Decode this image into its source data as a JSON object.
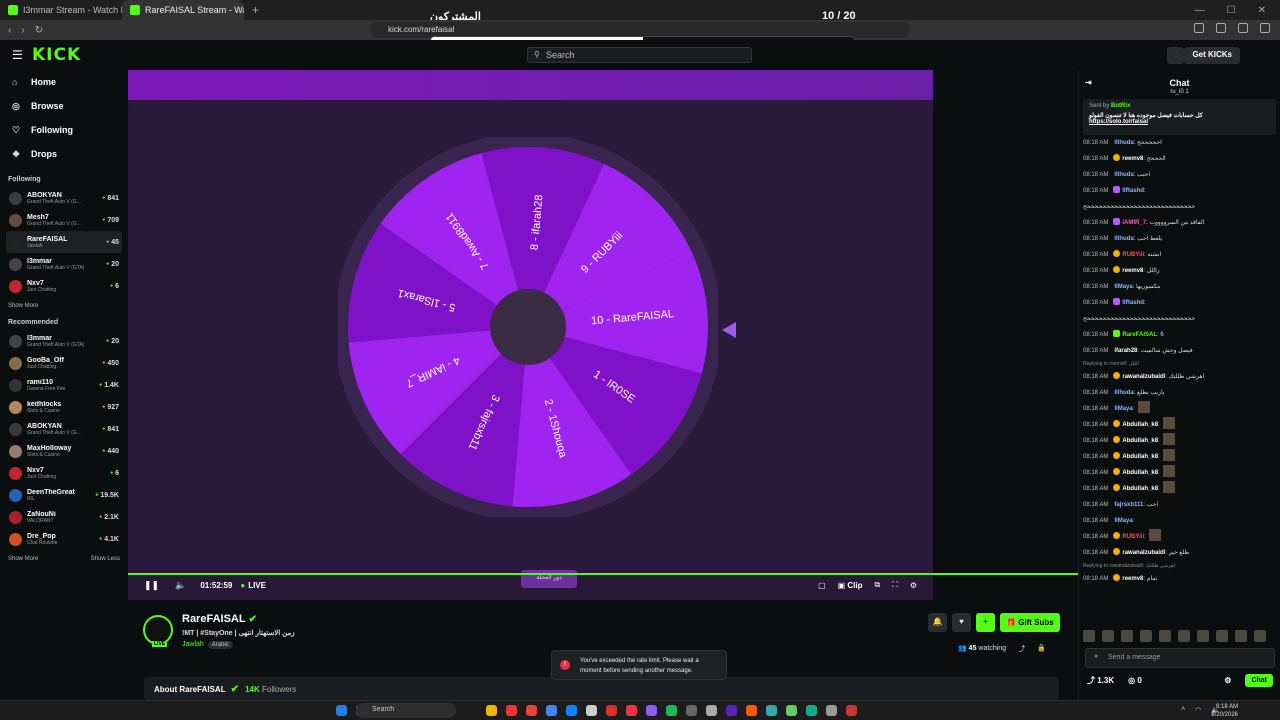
{
  "browser": {
    "tabs": [
      {
        "label": "I3mmar Stream - Watch Live on K",
        "active": false
      },
      {
        "label": "RareFAISAL Stream - Watch Li",
        "active": true
      }
    ],
    "url": "kick.com/rarefaisal",
    "overlay_title": "المشتركون",
    "overlay_count": "10 / 20",
    "overlay_progress": 0.5
  },
  "topbar": {
    "logo": "KICK",
    "search_placeholder": "Search",
    "get_kicks": "Get KICKs"
  },
  "sidebar": {
    "nav": [
      {
        "label": "Home",
        "icon": "home-icon"
      },
      {
        "label": "Browse",
        "icon": "compass-icon"
      },
      {
        "label": "Following",
        "icon": "heart-icon"
      },
      {
        "label": "Drops",
        "icon": "drops-icon"
      }
    ],
    "following_title": "Following",
    "following": [
      {
        "name": "ABOKYAN",
        "cat": "Grand Theft Auto V (G...",
        "viewers": "841",
        "color": "#3b3b3b"
      },
      {
        "name": "Mesh7",
        "cat": "Grand Theft Auto V (G...",
        "viewers": "709",
        "color": "#6a4b3a"
      },
      {
        "name": "RareFAISAL",
        "cat": "Jawlah",
        "viewers": "45",
        "color": "#222",
        "active": true
      },
      {
        "name": "I3mmar",
        "cat": "Grand Theft Auto V (GTA)",
        "viewers": "20",
        "color": "#444"
      },
      {
        "name": "Nxv7",
        "cat": "Just Chatting",
        "viewers": "6",
        "color": "#c0262d"
      }
    ],
    "show_more": "Show More",
    "recommended_title": "Recommended",
    "recommended": [
      {
        "name": "I3mmar",
        "cat": "Grand Theft Auto V (GTA)",
        "viewers": "20",
        "color": "#444"
      },
      {
        "name": "GooBa_Off",
        "cat": "Just Chatting",
        "viewers": "450",
        "color": "#8a6a4a"
      },
      {
        "name": "rami110",
        "cat": "Garena Free Fire",
        "viewers": "1.4K",
        "color": "#333"
      },
      {
        "name": "keithlocks",
        "cat": "Slots & Casino",
        "viewers": "927",
        "color": "#b58a5a"
      },
      {
        "name": "ABOKYAN",
        "cat": "Grand Theft Auto V (G...",
        "viewers": "841",
        "color": "#3b3b3b"
      },
      {
        "name": "MaxHolloway",
        "cat": "Slots & Casino",
        "viewers": "440",
        "color": "#9a7a6a"
      },
      {
        "name": "Nxv7",
        "cat": "Just Chatting",
        "viewers": "6",
        "color": "#c0262d"
      },
      {
        "name": "DeenTheGreat",
        "cat": "IRL",
        "viewers": "19.5K",
        "color": "#2b5fb5"
      },
      {
        "name": "ZaNouNi",
        "cat": "VALORANT",
        "viewers": "2.1K",
        "color": "#a8202a"
      },
      {
        "name": "Dre_Pop",
        "cat": "Chat Roulette",
        "viewers": "4.1K",
        "color": "#d0502a"
      }
    ],
    "show_more_2": "Show More",
    "show_less": "Show Less"
  },
  "wheel": {
    "segments": [
      {
        "label": "10 - RareFAISAL"
      },
      {
        "label": "1 - IR0SE"
      },
      {
        "label": "2 - 1Shouqa"
      },
      {
        "label": "3 - fajrsxb11"
      },
      {
        "label": "4 - iAMIR_7"
      },
      {
        "label": "5 - 1lSarax1"
      },
      {
        "label": "7 - Awad8911"
      },
      {
        "label": "8 - ifarah28"
      },
      {
        "label": "9 - RUBYiii"
      }
    ],
    "spin_label": "دور العجلة"
  },
  "player": {
    "time": "01:52:59",
    "live": "LIVE",
    "clip": "Clip"
  },
  "stream": {
    "name": "RareFAISAL",
    "title": "!MT | #StayOne | زمن الاستهتار انتهى",
    "category": "Jawlah",
    "language": "Arabic",
    "watching_count": "45",
    "watching_label": "watching",
    "gift_subs": "Gift Subs",
    "about_prefix": "About",
    "followers": "14K",
    "followers_label": "Followers"
  },
  "toast": {
    "message": "You've exceeded the rate limit. Please wait a moment before sending another message."
  },
  "chat": {
    "title": "Chat",
    "top_user": "ru_i0 1",
    "pinned_by": "Sent by",
    "pinned_user": "BotRix",
    "pinned_msg": "كل حسابات فيصل موجوده هنا لا تنسون الفولو",
    "pinned_url": "https://solo.to/rfaisal",
    "messages": [
      {
        "t": "08:18 AM",
        "u": "lllhuda",
        "c": "#8fb5ff",
        "msg": "احححححح",
        "b": ""
      },
      {
        "t": "08:18 AM",
        "u": "reemv8",
        "c": "#fff",
        "msg": "الحححح",
        "b": "y"
      },
      {
        "t": "08:18 AM",
        "u": "lllhuda",
        "c": "#8fb5ff",
        "msg": "احبب",
        "b": ""
      },
      {
        "t": "08:18 AM",
        "u": "llRashd",
        "c": "#8fb5ff",
        "msg": "",
        "b": "p"
      },
      {
        "t": "",
        "u": "",
        "c": "#fff",
        "msg": "ححححححححححححححححححححححححححححح",
        "b": ""
      },
      {
        "t": "08:18 AM",
        "u": "iAMIR_7",
        "c": "#ff5cb8",
        "msg": "الفاقد من السرووووت",
        "b": "p"
      },
      {
        "t": "08:18 AM",
        "u": "lllhuda",
        "c": "#8fb5ff",
        "msg": "يلعط احب",
        "b": ""
      },
      {
        "t": "08:18 AM",
        "u": "RUBYiii",
        "c": "#ff4b4b",
        "msg": "انشنه",
        "b": "y"
      },
      {
        "t": "08:18 AM",
        "u": "reemv8",
        "c": "#fff",
        "msg": "زاللل",
        "b": "y"
      },
      {
        "t": "08:18 AM",
        "u": "llMaya",
        "c": "#8fb5ff",
        "msg": "مكسوريها",
        "b": ""
      },
      {
        "t": "08:18 AM",
        "u": "llRashd",
        "c": "#8fb5ff",
        "msg": "",
        "b": "p"
      },
      {
        "t": "",
        "u": "",
        "c": "#fff",
        "msg": "ححححححححححححححححححححححححححححح",
        "b": ""
      },
      {
        "t": "08:18 AM",
        "u": "RareFAISAL",
        "c": "#53fc18",
        "msg": "6",
        "b": "g"
      },
      {
        "t": "08:18 AM",
        "u": "ifarah28",
        "c": "#fff",
        "msg": "فيصل وحش سالميت",
        "b": ""
      },
      {
        "t": "",
        "u": "",
        "c": "#888",
        "msg": "Replying to reemv8: الللل",
        "b": "",
        "reply": true
      },
      {
        "t": "08:18 AM",
        "u": "rawanalzubaidi",
        "c": "#fff",
        "msg": "اهرشي ظللتك",
        "b": "y"
      },
      {
        "t": "08:18 AM",
        "u": "lllhuda",
        "c": "#8fb5ff",
        "msg": "ياربب نطلع",
        "b": ""
      },
      {
        "t": "08:18 AM",
        "u": "llMaya",
        "c": "#8fb5ff",
        "msg": "",
        "b": "",
        "emote": true
      },
      {
        "t": "08:18 AM",
        "u": "Abdullah_k8",
        "c": "#fff",
        "msg": "",
        "b": "y",
        "emote": true
      },
      {
        "t": "08:18 AM",
        "u": "Abdullah_k8",
        "c": "#fff",
        "msg": "",
        "b": "y",
        "emote": true
      },
      {
        "t": "08:18 AM",
        "u": "Abdullah_k8",
        "c": "#fff",
        "msg": "",
        "b": "y",
        "emote": true
      },
      {
        "t": "08:18 AM",
        "u": "Abdullah_k8",
        "c": "#fff",
        "msg": "",
        "b": "y",
        "emote": true
      },
      {
        "t": "08:18 AM",
        "u": "Abdullah_k8",
        "c": "#fff",
        "msg": "",
        "b": "y",
        "emote": true
      },
      {
        "t": "08:18 AM",
        "u": "fajrsxb111",
        "c": "#8fb5ff",
        "msg": "احب",
        "b": ""
      },
      {
        "t": "08:18 AM",
        "u": "llMaya",
        "c": "#8fb5ff",
        "msg": "",
        "b": ""
      },
      {
        "t": "08:18 AM",
        "u": "RUBYiii",
        "c": "#ff4b4b",
        "msg": "",
        "b": "y",
        "emote": true
      },
      {
        "t": "08:18 AM",
        "u": "rawanalzubaidi",
        "c": "#fff",
        "msg": "طلع خير",
        "b": "y"
      },
      {
        "t": "",
        "u": "",
        "c": "#888",
        "msg": "Replying to rawanalzubaidi: اهرشي ظللتك",
        "b": "",
        "reply": true
      },
      {
        "t": "08:18 AM",
        "u": "reemv8",
        "c": "#fff",
        "msg": "تمام",
        "b": "y"
      }
    ],
    "input_placeholder": "Send a message",
    "likes": "1.3K",
    "points": "0",
    "send": "Chat"
  },
  "taskbar": {
    "search": "Search",
    "time": "8:18 AM",
    "date": "8/20/2026"
  }
}
